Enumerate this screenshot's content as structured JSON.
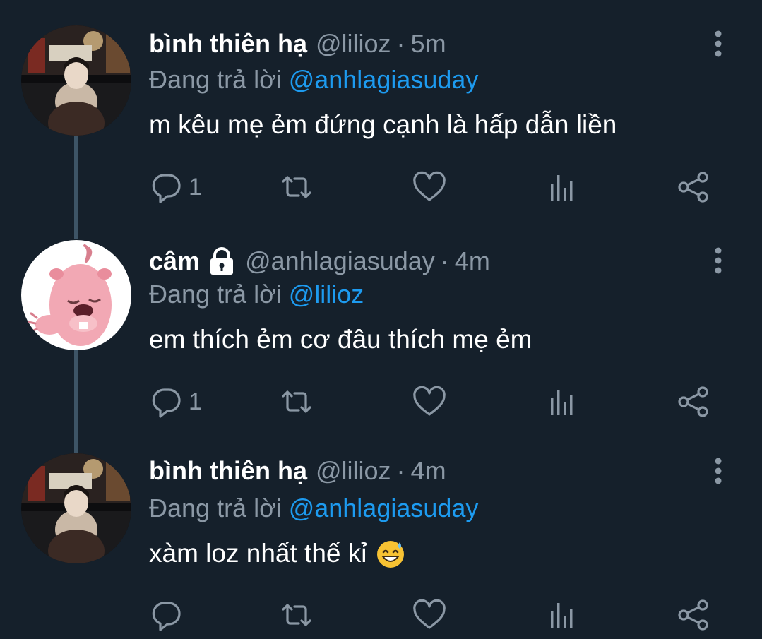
{
  "thread": {
    "tweets": [
      {
        "name": "bình thiên hạ",
        "handle": "@lilioz",
        "separator": "·",
        "time": "5m",
        "replying_label": "Đang trả lời",
        "replying_to": "@anhlagiasuday",
        "text": "m kêu mẹ ẻm đứng cạnh là hấp dẫn liền",
        "reply_count": "1",
        "avatar": "person-photo-avatar",
        "locked": false
      },
      {
        "name": "câm",
        "handle": "@anhlagiasuday",
        "separator": "·",
        "time": "4m",
        "replying_label": "Đang trả lời",
        "replying_to": "@lilioz",
        "text": "em thích ẻm cơ đâu thích mẹ ẻm",
        "reply_count": "1",
        "avatar": "pink-beaver-avatar",
        "locked": true
      },
      {
        "name": "bình thiên hạ",
        "handle": "@lilioz",
        "separator": "·",
        "time": "4m",
        "replying_label": "Đang trả lời",
        "replying_to": "@anhlagiasuday",
        "text": "xàm loz nhất thế kỉ",
        "reply_count": "",
        "avatar": "person-photo-avatar",
        "locked": false,
        "emoji": "grinning-face-with-sweat"
      }
    ]
  },
  "icons": {
    "reply": "reply-icon",
    "retweet": "retweet-icon",
    "like": "heart-icon",
    "views": "views-icon",
    "share": "share-icon",
    "more": "more-options-icon",
    "lock": "lock-icon"
  },
  "colors": {
    "background": "#15202b",
    "text": "#ffffff",
    "secondary": "#8b98a5",
    "mention": "#1d9bf0",
    "thread_line": "#3d5466"
  }
}
